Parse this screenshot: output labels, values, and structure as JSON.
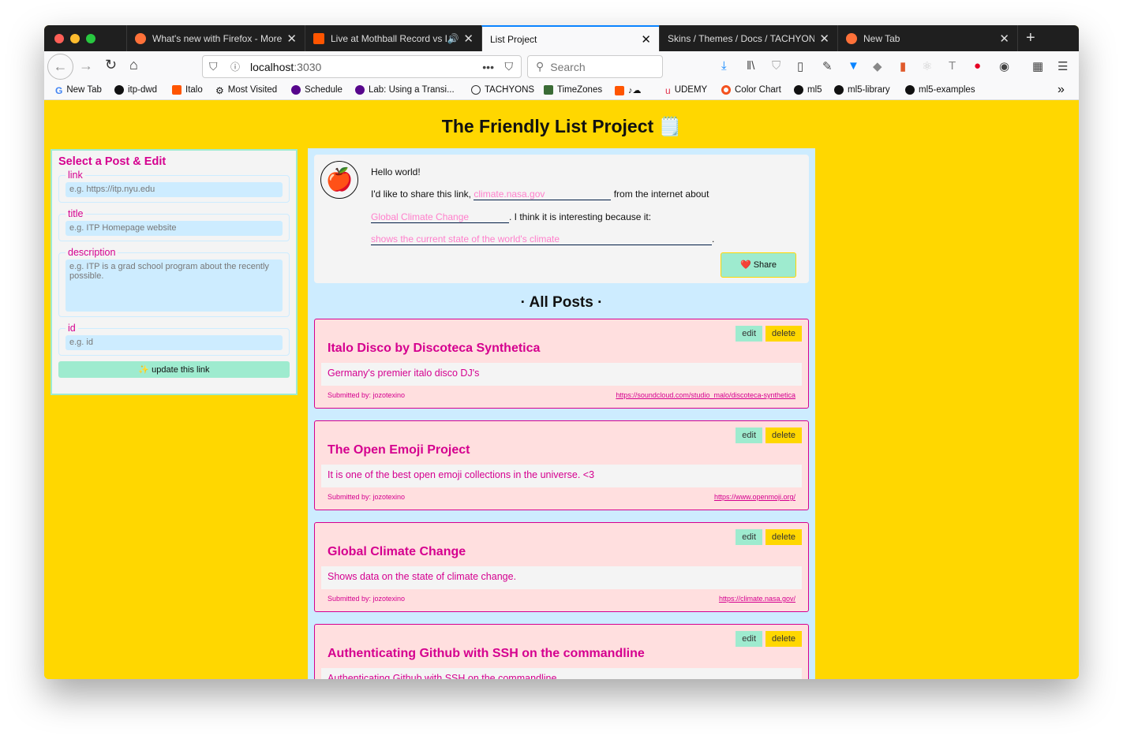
{
  "browser": {
    "tabs": [
      {
        "title": "What's new with Firefox - More",
        "active": false
      },
      {
        "title": "Live at Mothball Record vs D",
        "active": false
      },
      {
        "title": "List Project",
        "active": true
      },
      {
        "title": "Skins / Themes / Docs / TACHYONS",
        "active": false
      },
      {
        "title": "New Tab",
        "active": false
      }
    ],
    "url_host": "localhost",
    "url_port": ":3030",
    "search_placeholder": "Search",
    "bookmarks": [
      "New Tab",
      "itp-dwd",
      "Italo",
      "Most Visited",
      "Schedule",
      "Lab: Using a Transi...",
      "TACHYONS",
      "TimeZones",
      "",
      "UDEMY",
      "Color Chart",
      "ml5",
      "ml5-library",
      "ml5-examples"
    ]
  },
  "page": {
    "title": "The Friendly List Project 🗒️",
    "edit_panel": {
      "heading": "Select a Post & Edit",
      "fields": [
        {
          "label": "link",
          "placeholder": "e.g. https://itp.nyu.edu"
        },
        {
          "label": "title",
          "placeholder": "e.g. ITP Homepage website"
        },
        {
          "label": "description",
          "placeholder": "e.g. ITP is a grad school program about the recently possible."
        },
        {
          "label": "id",
          "placeholder": "e.g. id"
        }
      ],
      "update_label": "✨ update this link"
    },
    "share": {
      "greeting": "Hello world!",
      "line1_prefix": "I'd like to share this link,",
      "link_value": "climate.nasa.gov",
      "line1_suffix": "from the internet about",
      "title_value": "Global Climate Change",
      "line2_suffix": ". I think it is interesting because it:",
      "reason_value": "shows the current state of the world's climate",
      "reason_suffix": ".",
      "button": "❤️ Share"
    },
    "all_posts_heading": "· All Posts ·",
    "edit_label": "edit",
    "delete_label": "delete",
    "posts": [
      {
        "title": "Italo Disco by Discoteca Synthetica",
        "description": "Germany's premier italo disco DJ's",
        "submitted": "Submitted by: jozotexino",
        "url": "https://soundcloud.com/studio_malo/discoteca-synthetica"
      },
      {
        "title": "The Open Emoji Project",
        "description": "It is one of the best open emoji collections in the universe. <3",
        "submitted": "Submitted by: jozotexino",
        "url": "https://www.openmoji.org/"
      },
      {
        "title": "Global Climate Change",
        "description": "Shows data on the state of climate change.",
        "submitted": "Submitted by: jozotexino",
        "url": "https://climate.nasa.gov/"
      },
      {
        "title": "Authenticating Github with SSH on the commandline",
        "description": "Authenticating Github with SSH on the commandline",
        "submitted": "",
        "url": ""
      }
    ]
  }
}
